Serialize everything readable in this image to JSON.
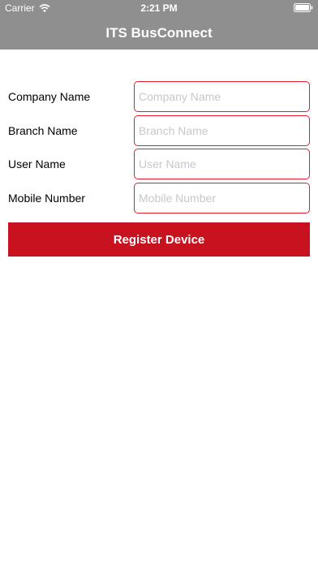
{
  "status_bar": {
    "carrier": "Carrier",
    "time": "2:21 PM"
  },
  "nav": {
    "title": "ITS BusConnect"
  },
  "form": {
    "rows": [
      {
        "label": "Company Name",
        "value": "",
        "placeholder": "Company Name"
      },
      {
        "label": "Branch Name",
        "value": "",
        "placeholder": "Branch Name"
      },
      {
        "label": "User Name",
        "value": "",
        "placeholder": "User Name"
      },
      {
        "label": "Mobile Number",
        "value": "",
        "placeholder": "Mobile Number"
      }
    ],
    "submit_label": "Register Device"
  },
  "colors": {
    "bar_background": "#8f8f8f",
    "field_border": "#e21d2e",
    "button_background": "#c8121f"
  },
  "icons": [
    "wifi-icon",
    "battery-icon"
  ]
}
